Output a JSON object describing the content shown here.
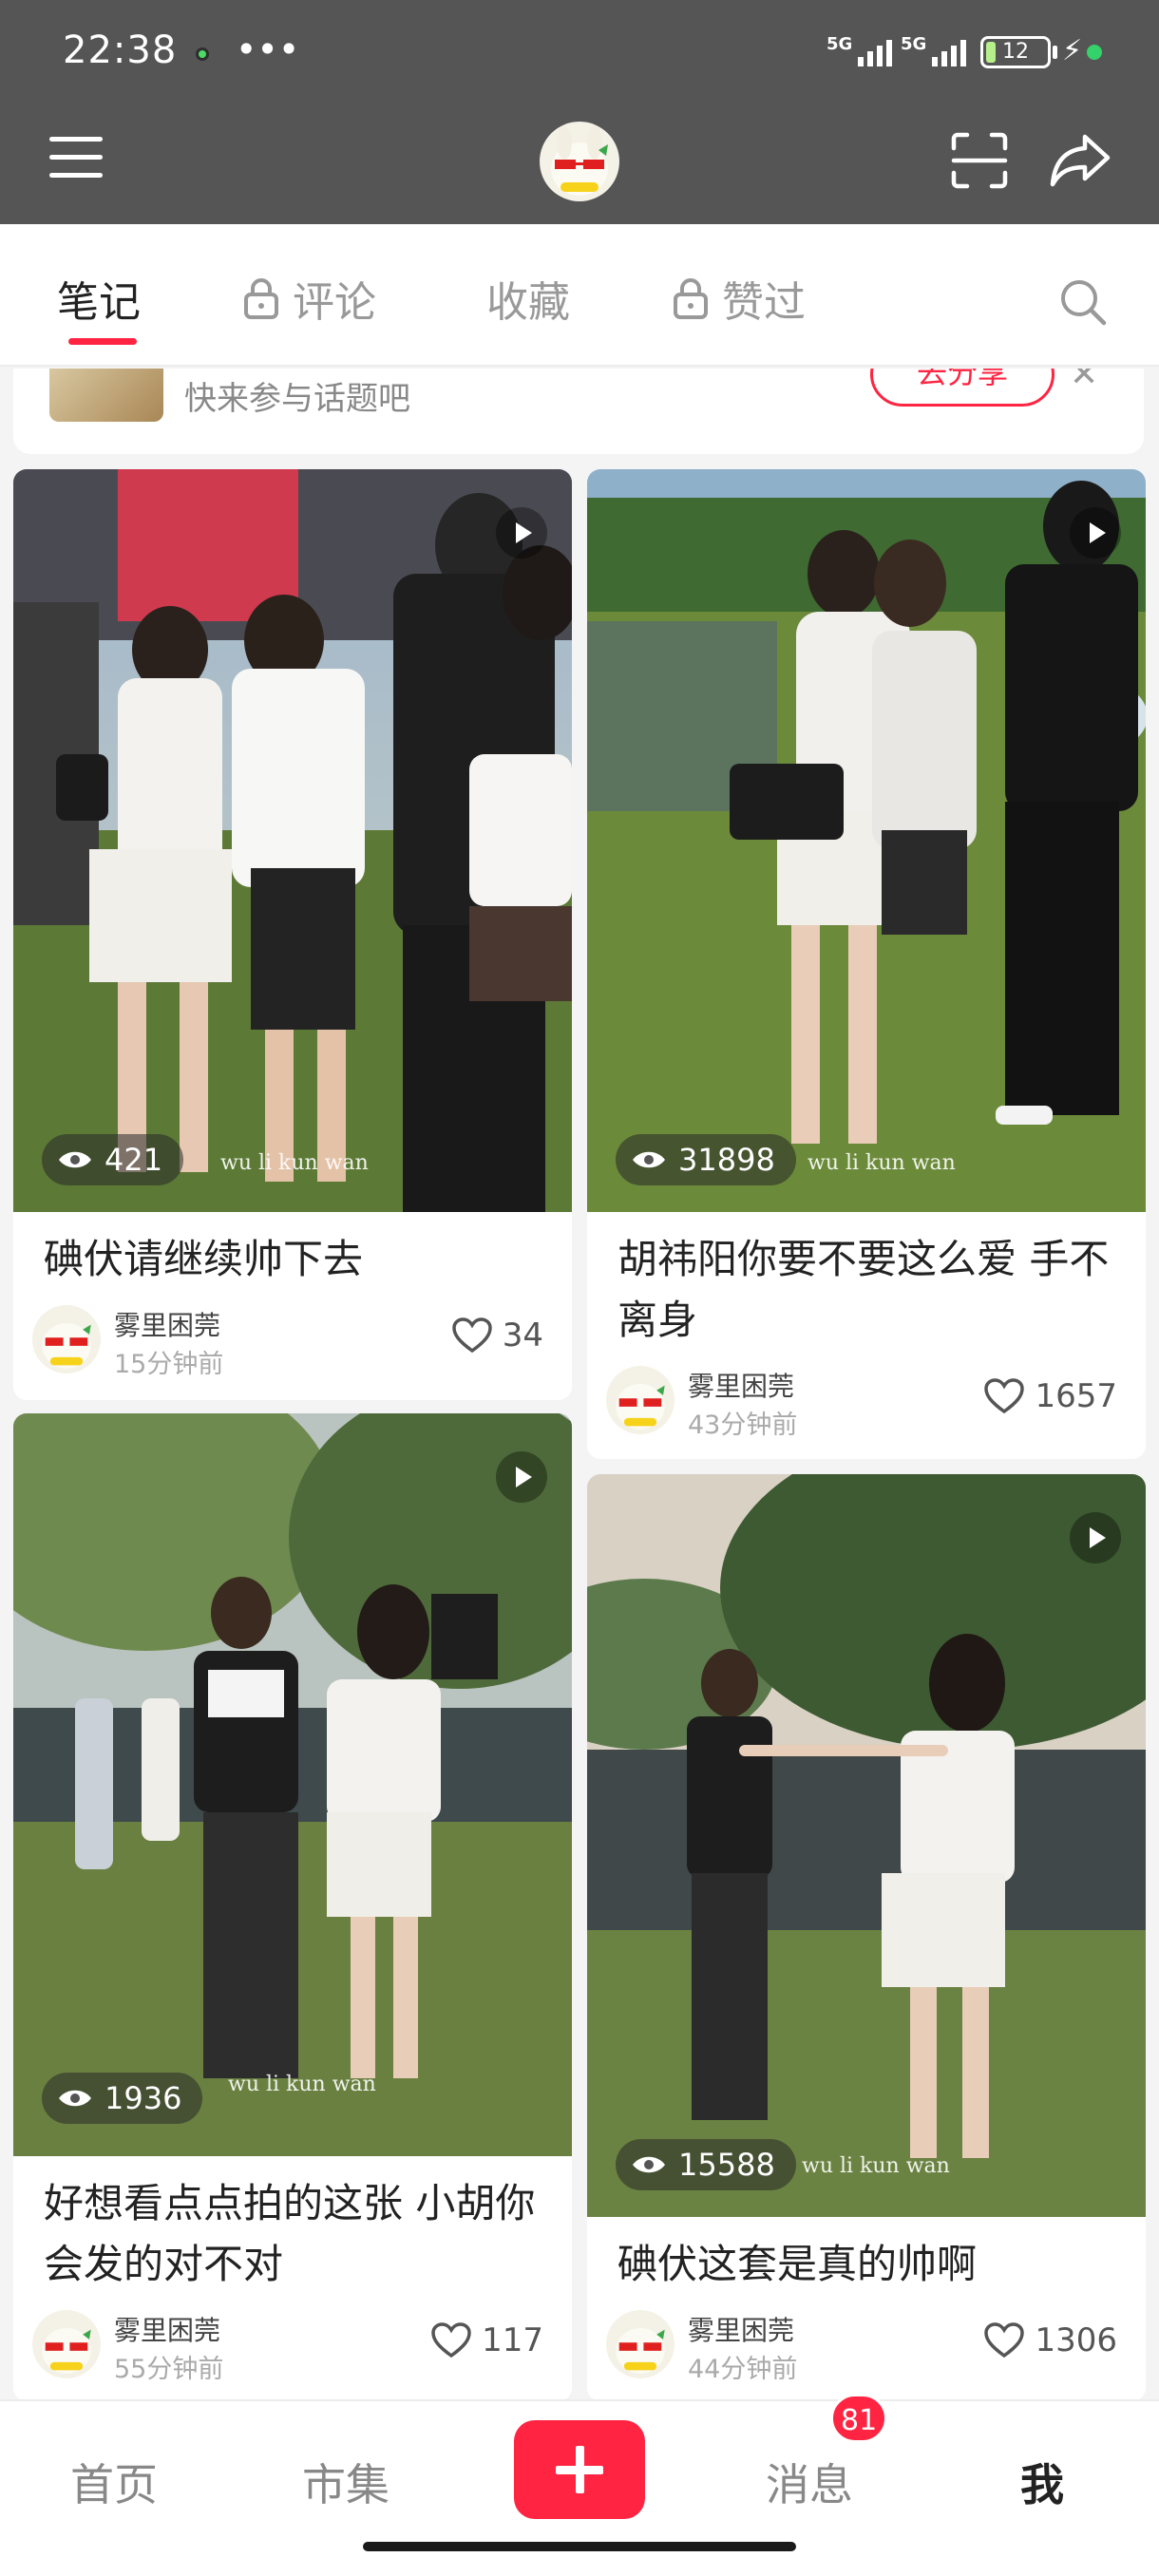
{
  "status": {
    "time": "22:38",
    "more": "•••",
    "signal1": "5G",
    "signal2": "5G",
    "battery": "12"
  },
  "tabs": [
    {
      "label": "笔记",
      "locked": false,
      "active": true
    },
    {
      "label": "评论",
      "locked": true,
      "active": false
    },
    {
      "label": "收藏",
      "locked": false,
      "active": false
    },
    {
      "label": "赞过",
      "locked": true,
      "active": false
    }
  ],
  "banner": {
    "text": "快来参与话题吧",
    "button": "去分享"
  },
  "cards": [
    {
      "title": "碘伏请继续帅下去",
      "views": "421",
      "watermark": "wu li kun wan",
      "author": "雾里困莞",
      "time": "15分钟前",
      "likes": "34"
    },
    {
      "title": "胡祎阳你要不要这么爱 手不离身",
      "views": "31898",
      "watermark": "wu li kun wan",
      "author": "雾里困莞",
      "time": "43分钟前",
      "likes": "1657"
    },
    {
      "title": "好想看点点拍的这张 小胡你会发的对不对",
      "views": "1936",
      "watermark": "wu li kun wan",
      "author": "雾里困莞",
      "time": "55分钟前",
      "likes": "117"
    },
    {
      "title": "碘伏这套是真的帅啊",
      "views": "15588",
      "watermark": "wu li kun wan",
      "author": "雾里困莞",
      "time": "44分钟前",
      "likes": "1306"
    }
  ],
  "bottom_nav": {
    "home": "首页",
    "market": "市集",
    "messages": "消息",
    "messages_badge": "81",
    "me": "我"
  },
  "colors": {
    "accent": "#ff2442",
    "header": "#555555"
  }
}
